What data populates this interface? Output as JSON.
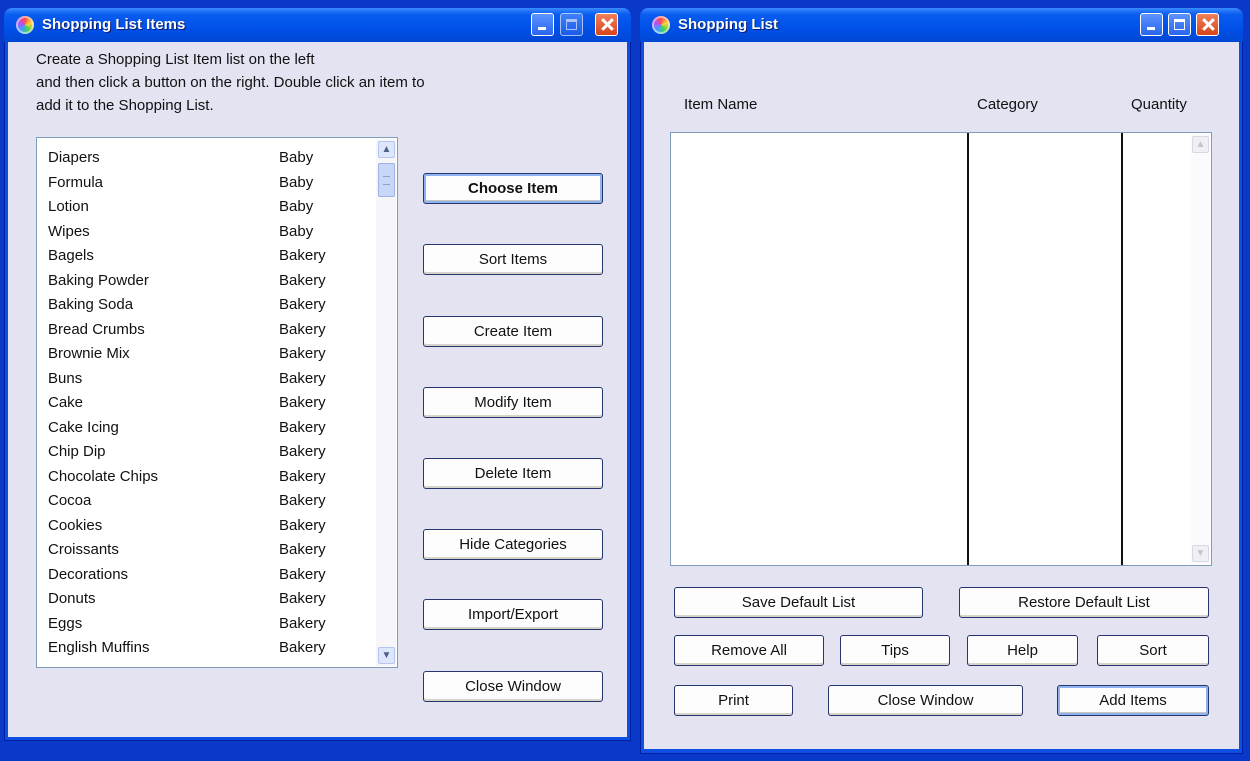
{
  "items_window": {
    "title": "Shopping List Items",
    "instructions": [
      "Create a Shopping List Item list on the left",
      "and then click a button on the right. Double click an item to",
      "add it to the Shopping List."
    ],
    "items": [
      {
        "name": "Diapers",
        "category": "Baby"
      },
      {
        "name": "Formula",
        "category": "Baby"
      },
      {
        "name": "Lotion",
        "category": "Baby"
      },
      {
        "name": "Wipes",
        "category": "Baby"
      },
      {
        "name": "Bagels",
        "category": "Bakery"
      },
      {
        "name": "Baking Powder",
        "category": "Bakery"
      },
      {
        "name": "Baking Soda",
        "category": "Bakery"
      },
      {
        "name": "Bread Crumbs",
        "category": "Bakery"
      },
      {
        "name": "Brownie Mix",
        "category": "Bakery"
      },
      {
        "name": "Buns",
        "category": "Bakery"
      },
      {
        "name": "Cake",
        "category": "Bakery"
      },
      {
        "name": "Cake Icing",
        "category": "Bakery"
      },
      {
        "name": "Chip Dip",
        "category": "Bakery"
      },
      {
        "name": "Chocolate Chips",
        "category": "Bakery"
      },
      {
        "name": "Cocoa",
        "category": "Bakery"
      },
      {
        "name": "Cookies",
        "category": "Bakery"
      },
      {
        "name": "Croissants",
        "category": "Bakery"
      },
      {
        "name": "Decorations",
        "category": "Bakery"
      },
      {
        "name": "Donuts",
        "category": "Bakery"
      },
      {
        "name": "Eggs",
        "category": "Bakery"
      },
      {
        "name": "English Muffins",
        "category": "Bakery"
      }
    ],
    "buttons": {
      "choose_item": "Choose Item",
      "sort_items": "Sort Items",
      "create_item": "Create Item",
      "modify_item": "Modify Item",
      "delete_item": "Delete Item",
      "hide_categories": "Hide Categories",
      "import_export": "Import/Export",
      "close_window": "Close Window"
    }
  },
  "list_window": {
    "title": "Shopping List",
    "columns": {
      "item_name": "Item Name",
      "category": "Category",
      "quantity": "Quantity"
    },
    "rows": [],
    "buttons": {
      "save_default": "Save Default List",
      "restore_default": "Restore Default List",
      "remove_all": "Remove All",
      "tips": "Tips",
      "help": "Help",
      "sort": "Sort",
      "print": "Print",
      "close_window": "Close Window",
      "add_items": "Add Items"
    }
  }
}
